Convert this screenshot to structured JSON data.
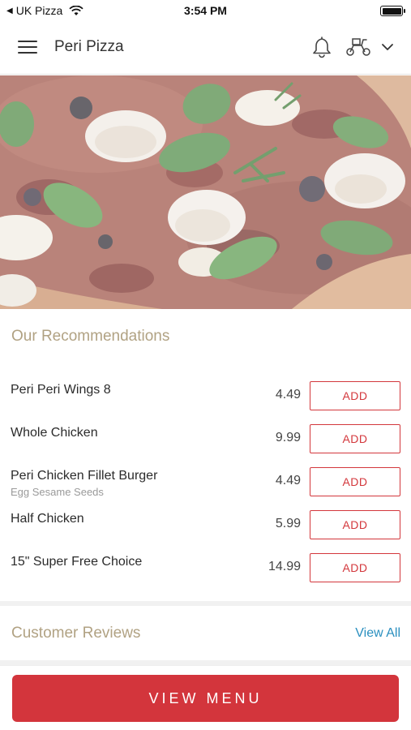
{
  "status_bar": {
    "carrier": "UK Pizza",
    "time": "3:54 PM"
  },
  "header": {
    "title": "Peri Pizza",
    "icons": [
      "menu-icon",
      "bell-icon",
      "scooter-icon",
      "chevron-down-icon"
    ]
  },
  "hero": {
    "image": "pizza-photo"
  },
  "recommendations": {
    "title": "Our Recommendations",
    "items": [
      {
        "name": "Peri Peri Wings 8",
        "desc": "",
        "price": "4.49",
        "action": "ADD"
      },
      {
        "name": "Whole Chicken",
        "desc": "",
        "price": "9.99",
        "action": "ADD"
      },
      {
        "name": "Peri Chicken Fillet Burger",
        "desc": "Egg Sesame Seeds",
        "price": "4.49",
        "action": "ADD"
      },
      {
        "name": "Half Chicken",
        "desc": "",
        "price": "5.99",
        "action": "ADD"
      },
      {
        "name": "15\" Super Free Choice",
        "desc": "",
        "price": "14.99",
        "action": "ADD"
      }
    ]
  },
  "reviews": {
    "title": "Customer Reviews",
    "view_all": "View All"
  },
  "footer": {
    "button": "VIEW MENU"
  },
  "colors": {
    "accent_red": "#d3353c",
    "section_title": "#b1a283",
    "link_blue": "#2a8fbf"
  }
}
